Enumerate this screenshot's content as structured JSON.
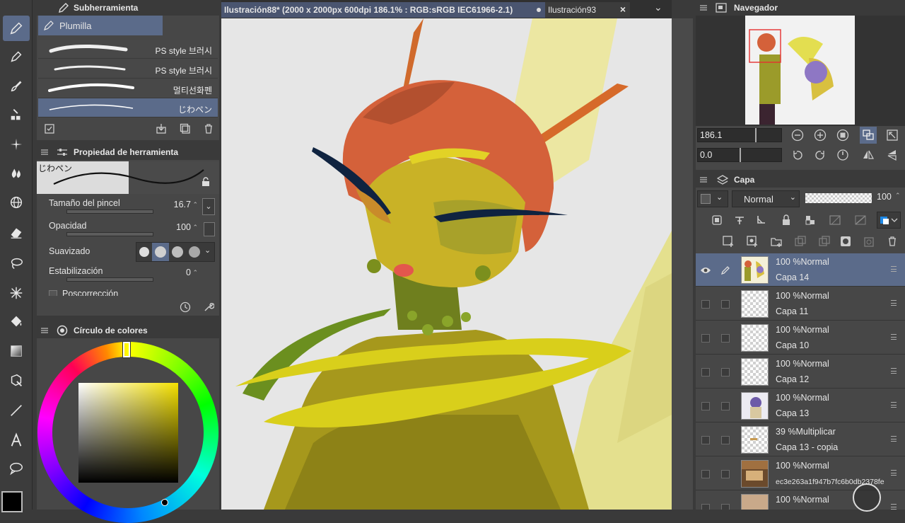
{
  "subtool_panel": {
    "title": "Subherramienta",
    "active_group": "Plumilla",
    "brushes": [
      {
        "name": "PS style 브러시"
      },
      {
        "name": "PS style 브러시"
      },
      {
        "name": "멀티선화펜"
      },
      {
        "name": "じわペン"
      }
    ]
  },
  "tool_property": {
    "title": "Propiedad de herramienta",
    "preview_name": "じわペン",
    "brush_size_label": "Tamaño del pincel",
    "brush_size_value": "16.7",
    "opacity_label": "Opacidad",
    "opacity_value": "100",
    "smoothing_label": "Suavizado",
    "stabilization_label": "Estabilización",
    "stabilization_value": "0",
    "post_correction_label": "Poscorrección"
  },
  "color_wheel": {
    "title": "Círculo de colores",
    "hue_color": "#f5e100"
  },
  "tabs": [
    {
      "label": "Ilustración88* (2000 x 2000px 600dpi 186.1% : RGB:sRGB IEC61966-2.1)"
    },
    {
      "label": "Ilustración93"
    }
  ],
  "navigator": {
    "title": "Navegador",
    "zoom_value": "186.1",
    "rotation_value": "0.0"
  },
  "layer_panel": {
    "title": "Capa",
    "blend_mode": "Normal",
    "opacity_value": "100",
    "layers": [
      {
        "mode": "100 %Normal",
        "name": "Capa 14",
        "selected": true,
        "visible": true
      },
      {
        "mode": "100 %Normal",
        "name": "Capa 11",
        "selected": false,
        "visible": false
      },
      {
        "mode": "100 %Normal",
        "name": "Capa 10",
        "selected": false,
        "visible": false
      },
      {
        "mode": "100 %Normal",
        "name": "Capa 12",
        "selected": false,
        "visible": false
      },
      {
        "mode": "100 %Normal",
        "name": "Capa 13",
        "selected": false,
        "visible": false
      },
      {
        "mode": "39 %Multiplicar",
        "name": "Capa 13 - copia",
        "selected": false,
        "visible": false
      },
      {
        "mode": "100 %Normal",
        "name": "ec3e263a1f947b7fc6b0db2378fe",
        "selected": false,
        "visible": false
      },
      {
        "mode": "100 %Normal",
        "name": "",
        "selected": false,
        "visible": false
      }
    ]
  },
  "colors": {
    "accent": "#5b6b8a",
    "panel_bg": "#474747",
    "canvas_bg": "#e6e6e6"
  }
}
